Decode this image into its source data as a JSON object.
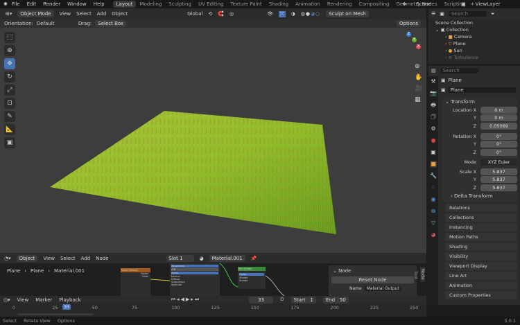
{
  "menu": [
    "File",
    "Edit",
    "Render",
    "Window",
    "Help"
  ],
  "workspaces": [
    "Layout",
    "Modeling",
    "Sculpting",
    "UV Editing",
    "Texture Paint",
    "Shading",
    "Animation",
    "Rendering",
    "Compositing",
    "Geometry Nodes",
    "Scripting"
  ],
  "scene": "Scene",
  "view_layer": "ViewLayer",
  "viewport_header": {
    "mode": "Object Mode",
    "menus": [
      "View",
      "Select",
      "Add",
      "Object"
    ],
    "transform": "Global",
    "sculpt": "Sculpt on Mesh",
    "orientation_label": "Orientation:",
    "orientation": "Default",
    "drag_label": "Drag:",
    "drag": "Select Box",
    "options": "Options"
  },
  "outliner": {
    "search": "Search",
    "scene_collection": "Scene Collection",
    "collection": "Collection",
    "items": [
      "Camera",
      "Plane",
      "Sun",
      "Turbulence"
    ]
  },
  "properties": {
    "search": "Search",
    "object_name": "Plane",
    "data_name": "Plane",
    "transform": "Transform",
    "location_label": "Location X",
    "rotation_label": "Rotation X",
    "scale_label": "Scale X",
    "y": "Y",
    "z": "Z",
    "location": [
      "0 m",
      "0 m",
      "0.05069"
    ],
    "rotation": [
      "0°",
      "0°",
      "0°"
    ],
    "mode_label": "Mode",
    "mode": "XYZ Euler",
    "scale": [
      "5.837",
      "5.837",
      "5.837"
    ],
    "delta": "Delta Transform",
    "panels": [
      "Relations",
      "Collections",
      "Instancing",
      "Motion Paths",
      "Shading",
      "Visibility",
      "Viewport Display",
      "Line Art",
      "Animation",
      "Custom Properties"
    ]
  },
  "node_editor": {
    "type": "Object",
    "menus": [
      "View",
      "Select",
      "Add",
      "Node"
    ],
    "slot": "Slot 1",
    "material": "Material.001",
    "breadcrumb": [
      "Plane",
      "Plane",
      "Material.001"
    ],
    "side_tabs": [
      "Node",
      "Tool"
    ],
    "panel_title": "Node",
    "reset": "Reset Node",
    "name_label": "Name",
    "name_value": "Material Output",
    "nodes": {
      "noise": "Noise Texture",
      "mix": "Mix Shader",
      "roughness": "Roughness",
      "ior": "IOR",
      "alpha": "Alpha",
      "normal": "Normal",
      "diffuse": "Diffuse",
      "subsurface": "Subsurface",
      "specular": "Specular",
      "factor": "Factor",
      "color": "Color",
      "fac": "Factor",
      "shader": "Shader"
    }
  },
  "timeline": {
    "menus": [
      "View",
      "Marker",
      "Playback"
    ],
    "current": "33",
    "start_label": "Start",
    "start": "1",
    "end_label": "End",
    "end": "50",
    "ticks": [
      "0",
      "25",
      "50",
      "75",
      "100",
      "125",
      "150",
      "175",
      "200",
      "225",
      "250"
    ]
  },
  "status": {
    "items": [
      "Select",
      "Rotate View",
      "Options"
    ],
    "version": "5.0.1"
  }
}
